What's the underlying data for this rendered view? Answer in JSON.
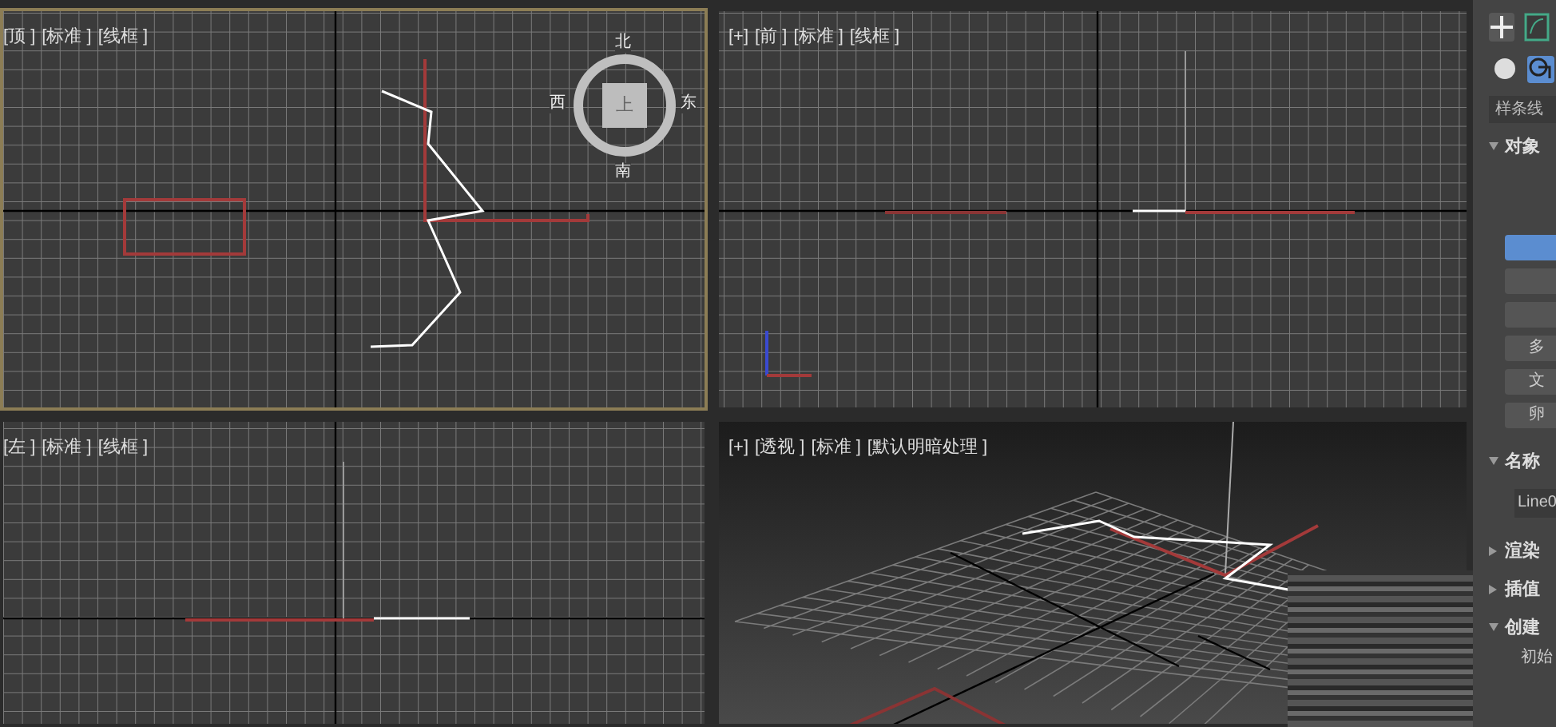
{
  "viewports": [
    {
      "kind": "top",
      "selected": true,
      "labels": [
        "[顶 ]",
        "[标准 ]",
        "[线框 ]"
      ],
      "compass": {
        "north": "北",
        "east": "东",
        "south": "南",
        "west": "西",
        "top": "上"
      }
    },
    {
      "kind": "front",
      "selected": false,
      "labels": [
        "[+]",
        "[前 ]",
        "[标准 ]",
        "[线框 ]"
      ]
    },
    {
      "kind": "left",
      "selected": false,
      "labels": [
        "[左 ]",
        "[标准 ]",
        "[线框 ]"
      ]
    },
    {
      "kind": "perspective",
      "selected": false,
      "labels": [
        "[+]",
        "[透视 ]",
        "[标准 ]",
        "[默认明暗处理 ]"
      ]
    }
  ],
  "command_panel": {
    "tabs": [
      {
        "kind": "create",
        "selected": true
      },
      {
        "kind": "modify",
        "selected": false
      }
    ],
    "categories": [
      {
        "kind": "geometry",
        "selected": false
      },
      {
        "kind": "shapes",
        "selected": true
      }
    ],
    "dropdown": "样条线",
    "rollouts": [
      {
        "title": "对象",
        "expanded": true,
        "buttons": [
          {
            "selected": true
          },
          {
            "selected": false
          },
          {
            "selected": false
          },
          {
            "label": "多",
            "selected": false
          },
          {
            "label": "文",
            "selected": false
          },
          {
            "label": "卵",
            "selected": false
          }
        ]
      },
      {
        "title": "名称",
        "expanded": true,
        "field": "Line0"
      },
      {
        "title": "渲染",
        "expanded": false
      },
      {
        "title": "插值",
        "expanded": false
      },
      {
        "title": "创建",
        "expanded": true,
        "text": "初始"
      }
    ]
  }
}
